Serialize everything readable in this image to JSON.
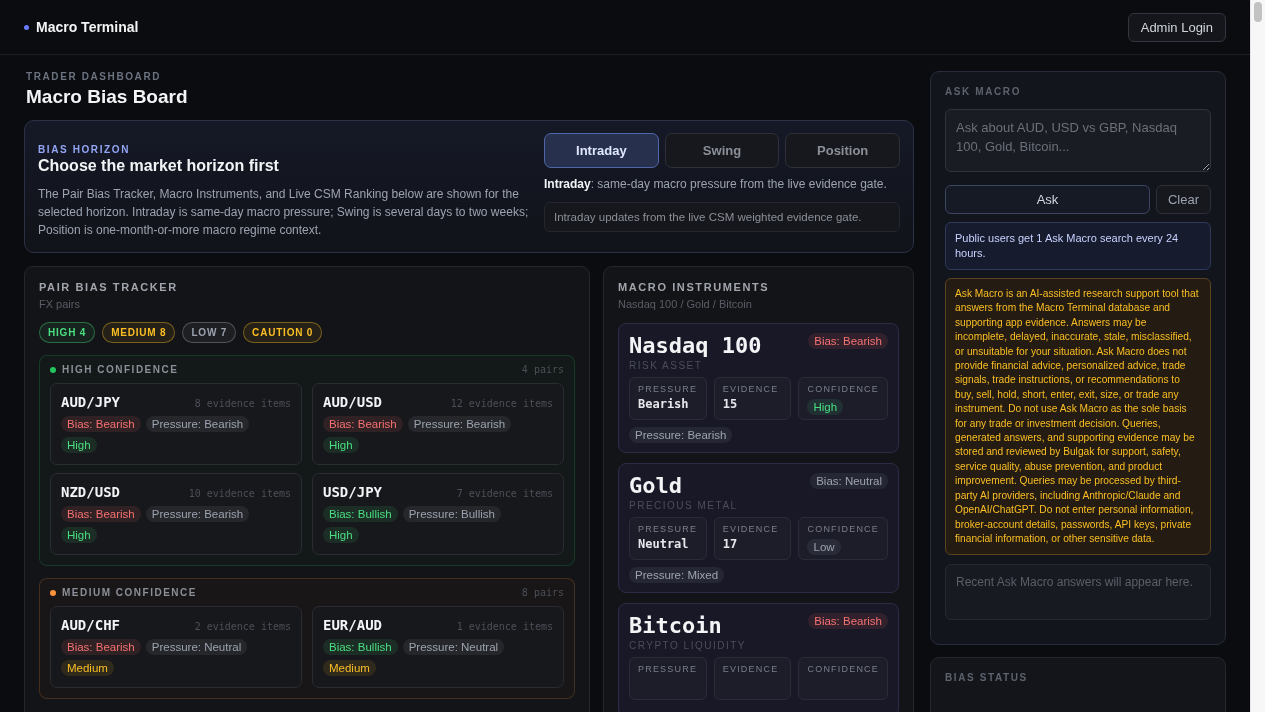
{
  "header": {
    "title": "Macro Terminal",
    "button": "Admin Login"
  },
  "dashboard": {
    "eyebrow": "TRADER DASHBOARD",
    "title": "Macro Bias Board"
  },
  "horizon": {
    "eyebrow": "BIAS HORIZON",
    "title": "Choose the market horizon first",
    "description": "The Pair Bias Tracker, Macro Instruments, and Live CSM Ranking below are shown for the selected horizon. Intraday is same-day macro pressure; Swing is several days to two weeks; Position is one-month-or-more macro regime context.",
    "tabs": [
      {
        "label": "Intraday",
        "selected": true
      },
      {
        "label": "Swing",
        "selected": false
      },
      {
        "label": "Position",
        "selected": false
      }
    ],
    "explanation": "**Intraday**: same-day macro pressure from the live evidence gate.",
    "note": "Intraday updates from the live CSM weighted evidence gate."
  },
  "pair_tracker": {
    "title": "PAIR BIAS TRACKER",
    "subtitle": "FX pairs",
    "summary": [
      {
        "label": "HIGH 4",
        "color": "#4ade80"
      },
      {
        "label": "MEDIUM 8",
        "color": "#fbbf24"
      },
      {
        "label": "LOW 7",
        "color": "#9ca3af"
      },
      {
        "label": "CAUTION 0",
        "color": "#fbbf24"
      }
    ],
    "groups": [
      {
        "title": "HIGH CONFIDENCE",
        "count": "4 pairs",
        "color": "#22c55e",
        "pairs": [
          {
            "pair": "AUD/JPY",
            "evidence": "8 evidence items",
            "tags": [
              {
                "label": "Bias: Bearish",
                "color": "#f87171"
              },
              {
                "label": "Pressure: Bearish",
                "color": "#9ca3af"
              },
              {
                "label": "High",
                "color": "#4ade80"
              }
            ]
          },
          {
            "pair": "AUD/USD",
            "evidence": "12 evidence items",
            "tags": [
              {
                "label": "Bias: Bearish",
                "color": "#f87171"
              },
              {
                "label": "Pressure: Bearish",
                "color": "#9ca3af"
              },
              {
                "label": "High",
                "color": "#4ade80"
              }
            ]
          },
          {
            "pair": "NZD/USD",
            "evidence": "10 evidence items",
            "tags": [
              {
                "label": "Bias: Bearish",
                "color": "#f87171"
              },
              {
                "label": "Pressure: Bearish",
                "color": "#9ca3af"
              },
              {
                "label": "High",
                "color": "#4ade80"
              }
            ]
          },
          {
            "pair": "USD/JPY",
            "evidence": "7 evidence items",
            "tags": [
              {
                "label": "Bias: Bullish",
                "color": "#4ade80"
              },
              {
                "label": "Pressure: Bullish",
                "color": "#9ca3af"
              },
              {
                "label": "High",
                "color": "#4ade80"
              }
            ]
          }
        ]
      },
      {
        "title": "MEDIUM CONFIDENCE",
        "count": "8 pairs",
        "color": "#fb923c",
        "pairs": [
          {
            "pair": "AUD/CHF",
            "evidence": "2 evidence items",
            "tags": [
              {
                "label": "Bias: Bearish",
                "color": "#f87171"
              },
              {
                "label": "Pressure: Neutral",
                "color": "#9ca3af"
              },
              {
                "label": "Medium",
                "color": "#fbbf24"
              }
            ]
          },
          {
            "pair": "EUR/AUD",
            "evidence": "1 evidence items",
            "tags": [
              {
                "label": "Bias: Bullish",
                "color": "#4ade80"
              },
              {
                "label": "Pressure: Neutral",
                "color": "#9ca3af"
              },
              {
                "label": "Medium",
                "color": "#fbbf24"
              }
            ]
          }
        ]
      }
    ]
  },
  "instruments": {
    "title": "MACRO INSTRUMENTS",
    "subtitle": "Nasdaq 100 / Gold / Bitcoin",
    "items": [
      {
        "name": "Nasdaq 100",
        "category": "RISK ASSET",
        "bias": {
          "label": "Bias: Bearish",
          "color": "#f87171"
        },
        "metrics": [
          {
            "label": "PRESSURE",
            "value": "Bearish",
            "kind": "text"
          },
          {
            "label": "EVIDENCE",
            "value": "15",
            "kind": "text"
          },
          {
            "label": "CONFIDENCE",
            "value": "High",
            "kind": "tag",
            "color": "#4ade80"
          }
        ],
        "tags": [
          {
            "label": "Pressure: Bearish",
            "color": "#9ca3af"
          }
        ]
      },
      {
        "name": "Gold",
        "category": "PRECIOUS METAL",
        "bias": {
          "label": "Bias: Neutral",
          "color": "#9ca3af"
        },
        "metrics": [
          {
            "label": "PRESSURE",
            "value": "Neutral",
            "kind": "text"
          },
          {
            "label": "EVIDENCE",
            "value": "17",
            "kind": "text"
          },
          {
            "label": "CONFIDENCE",
            "value": "Low",
            "kind": "tag",
            "color": "#9ca3af"
          }
        ],
        "tags": [
          {
            "label": "Pressure: Mixed",
            "color": "#9ca3af"
          }
        ]
      },
      {
        "name": "Bitcoin",
        "category": "CRYPTO LIQUIDITY",
        "bias": {
          "label": "Bias: Bearish",
          "color": "#f87171"
        },
        "metrics": [
          {
            "label": "PRESSURE"
          },
          {
            "label": "EVIDENCE"
          },
          {
            "label": "CONFIDENCE"
          }
        ]
      }
    ]
  },
  "ask_macro": {
    "title": "ASK MACRO",
    "placeholder": "Ask about AUD, USD vs GBP, Nasdaq 100, Gold, Bitcoin...",
    "ask_button": "Ask",
    "clear_button": "Clear",
    "quota_note": "Public users get 1 Ask Macro search every 24 hours.",
    "disclaimer": "Ask Macro is an AI-assisted research support tool that answers from the Macro Terminal database and supporting app evidence. Answers may be incomplete, delayed, inaccurate, stale, misclassified, or unsuitable for your situation. Ask Macro does not provide financial advice, personalized advice, trade signals, trade instructions, or recommendations to buy, sell, hold, short, enter, exit, size, or trade any instrument. Do not use Ask Macro as the sole basis for any trade or investment decision. Queries, generated answers, and supporting evidence may be stored and reviewed by Bulgak for support, safety, service quality, abuse prevention, and product improvement. Queries may be processed by third-party AI providers, including Anthropic/Claude and OpenAI/ChatGPT. Do not enter personal information, broker-account details, passwords, API keys, private financial information, or other sensitive data.",
    "recent_empty": "Recent Ask Macro answers will appear here."
  },
  "bias_status": {
    "title": "BIAS STATUS"
  }
}
